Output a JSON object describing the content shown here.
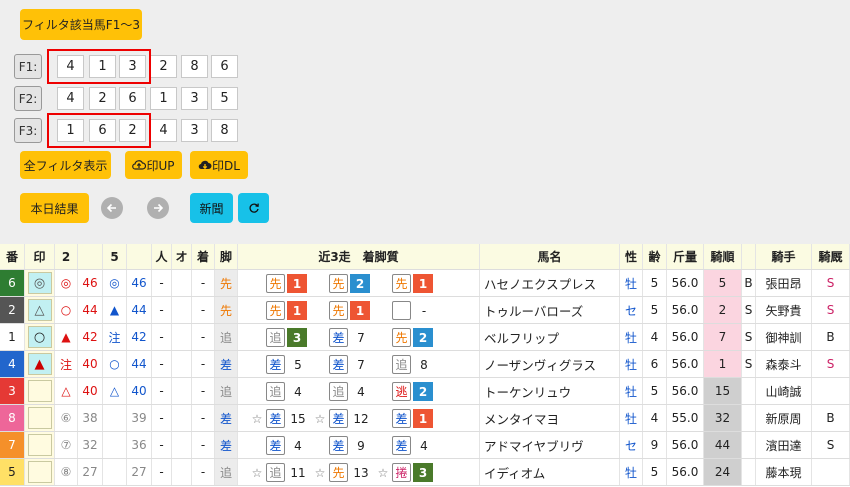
{
  "buttons": {
    "filter_hit": "フィルタ該当馬F1〜3",
    "all_filter": "全フィルタ表示",
    "upload": "印UP",
    "download": "印DL",
    "today_result": "本日結果",
    "new": "新聞"
  },
  "filters": [
    {
      "label": "F1:",
      "values": [
        "4",
        "1",
        "3",
        "2",
        "8",
        "6"
      ]
    },
    {
      "label": "F2:",
      "values": [
        "4",
        "2",
        "6",
        "1",
        "3",
        "5"
      ]
    },
    {
      "label": "F3:",
      "values": [
        "1",
        "6",
        "2",
        "4",
        "3",
        "8"
      ]
    }
  ],
  "colors": {
    "accent": "#ffc107",
    "cyan": "#17c1e8",
    "highlight": "#ee0000"
  },
  "table": {
    "headers": {
      "ban": "番",
      "mark": "印",
      "c2": "2",
      "c5": "5",
      "hito": "人",
      "o": "オ",
      "chaku": "着",
      "kyaku": "脚",
      "recent": "近3走　着脚質",
      "name": "馬名",
      "sex": "性",
      "age": "齢",
      "weight": "斤量",
      "rank": "騎順",
      "jockey": "騎手",
      "stable": "騎厩"
    },
    "rows": [
      {
        "ban": "6",
        "banBg": "#2e7d32",
        "banFg": "#fff",
        "mark": "◎",
        "markType": "dcircle",
        "m2": "◎",
        "m2c": "red",
        "n2": "46",
        "n2c": "red",
        "m5": "◎",
        "m5c": "blue",
        "n5": "46",
        "n5c": "blue",
        "hito": "-",
        "o": "",
        "chaku": "-",
        "kyaku": "先",
        "kyakuC": "orange",
        "pre": [
          "",
          "",
          ""
        ],
        "r": [
          {
            "s": "先",
            "sc": "orange",
            "n": "1",
            "nc": "#ee5533"
          },
          {
            "s": "先",
            "sc": "orange",
            "n": "2",
            "nc": "#2a8fcf"
          },
          {
            "s": "先",
            "sc": "orange",
            "n": "1",
            "nc": "#ee5533"
          }
        ],
        "name": "ハセノエクスプレス",
        "sex": "牡",
        "age": "5",
        "weight": "56.0",
        "rank": "5",
        "rankBg": "#fbd5e0",
        "b": "B",
        "jockey": "張田昂",
        "stable": "S",
        "stableC": "purple"
      },
      {
        "ban": "2",
        "banBg": "#555555",
        "banFg": "#fff",
        "mark": "△",
        "markType": "tri",
        "m2": "○",
        "m2c": "red",
        "n2": "44",
        "n2c": "red",
        "m5": "▲",
        "m5c": "blue",
        "n5": "44",
        "n5c": "blue",
        "hito": "-",
        "o": "",
        "chaku": "-",
        "kyaku": "先",
        "kyakuC": "orange",
        "pre": [
          "",
          "",
          ""
        ],
        "r": [
          {
            "s": "先",
            "sc": "orange",
            "n": "1",
            "nc": "#ee5533"
          },
          {
            "s": "先",
            "sc": "orange",
            "n": "1",
            "nc": "#ee5533"
          },
          {
            "s": "",
            "sc": "",
            "n": "-",
            "nc": ""
          }
        ],
        "name": "トゥルーバローズ",
        "sex": "セ",
        "age": "5",
        "weight": "56.0",
        "rank": "2",
        "rankBg": "#fbd5e0",
        "b": "S",
        "jockey": "矢野貴",
        "stable": "S",
        "stableC": "purple"
      },
      {
        "ban": "1",
        "banBg": "#ffffff",
        "banFg": "#222",
        "mark": "○",
        "markType": "circle",
        "m2": "▲",
        "m2c": "red",
        "n2": "42",
        "n2c": "red",
        "m5": "注",
        "m5c": "blue",
        "n5": "42",
        "n5c": "blue",
        "hito": "-",
        "o": "",
        "chaku": "-",
        "kyaku": "追",
        "kyakuC": "grey",
        "pre": [
          "",
          "",
          ""
        ],
        "r": [
          {
            "s": "追",
            "sc": "grey",
            "n": "3",
            "nc": "#4a7a2a"
          },
          {
            "s": "差",
            "sc": "blue",
            "n": "7",
            "nc": ""
          },
          {
            "s": "先",
            "sc": "orange",
            "n": "2",
            "nc": "#2a8fcf"
          }
        ],
        "name": "ベルフリップ",
        "sex": "牡",
        "age": "4",
        "weight": "56.0",
        "rank": "7",
        "rankBg": "#fbd5e0",
        "b": "S",
        "jockey": "御神訓",
        "stable": "B",
        "stableC": ""
      },
      {
        "ban": "4",
        "banBg": "#2266cc",
        "banFg": "#fff",
        "mark": "▲",
        "markType": "ftri",
        "m2": "注",
        "m2c": "red",
        "n2": "40",
        "n2c": "red",
        "m5": "○",
        "m5c": "blue",
        "n5": "44",
        "n5c": "blue",
        "hito": "-",
        "o": "",
        "chaku": "-",
        "kyaku": "差",
        "kyakuC": "blue",
        "pre": [
          "",
          "",
          ""
        ],
        "r": [
          {
            "s": "差",
            "sc": "blue",
            "n": "5",
            "nc": ""
          },
          {
            "s": "差",
            "sc": "blue",
            "n": "7",
            "nc": ""
          },
          {
            "s": "追",
            "sc": "grey",
            "n": "8",
            "nc": ""
          }
        ],
        "name": "ノーザンヴィグラス",
        "sex": "牡",
        "age": "6",
        "weight": "56.0",
        "rank": "1",
        "rankBg": "#fbd5e0",
        "b": "S",
        "jockey": "森泰斗",
        "stable": "S",
        "stableC": "purple"
      },
      {
        "ban": "3",
        "banBg": "#e53935",
        "banFg": "#fff",
        "mark": "",
        "markType": "",
        "m2": "△",
        "m2c": "red",
        "n2": "40",
        "n2c": "red",
        "m5": "△",
        "m5c": "blue",
        "n5": "40",
        "n5c": "blue",
        "hito": "-",
        "o": "",
        "chaku": "-",
        "kyaku": "追",
        "kyakuC": "grey",
        "pre": [
          "",
          "",
          ""
        ],
        "r": [
          {
            "s": "追",
            "sc": "grey",
            "n": "4",
            "nc": ""
          },
          {
            "s": "追",
            "sc": "grey",
            "n": "4",
            "nc": ""
          },
          {
            "s": "逃",
            "sc": "red",
            "n": "2",
            "nc": "#2a8fcf"
          }
        ],
        "name": "トーケンリュウ",
        "sex": "牡",
        "age": "5",
        "weight": "56.0",
        "rank": "15",
        "rankBg": "#cfcfcf",
        "b": "",
        "jockey": "山崎誠",
        "stable": "",
        "stableC": ""
      },
      {
        "ban": "8",
        "banBg": "#ee6699",
        "banFg": "#fff",
        "mark": "",
        "markType": "",
        "m2": "⑥",
        "m2c": "grey",
        "n2": "38",
        "n2c": "grey",
        "m5": "",
        "m5c": "",
        "n5": "39",
        "n5c": "grey",
        "hito": "-",
        "o": "",
        "chaku": "-",
        "kyaku": "差",
        "kyakuC": "blue",
        "pre": [
          "☆",
          "☆",
          ""
        ],
        "r": [
          {
            "s": "差",
            "sc": "blue",
            "n": "15",
            "nc": ""
          },
          {
            "s": "差",
            "sc": "blue",
            "n": "12",
            "nc": ""
          },
          {
            "s": "差",
            "sc": "blue",
            "n": "1",
            "nc": "#ee5533"
          }
        ],
        "name": "メンタイマヨ",
        "sex": "牡",
        "age": "4",
        "weight": "55.0",
        "rank": "32",
        "rankBg": "#cfcfcf",
        "b": "",
        "jockey": "新原周",
        "stable": "B",
        "stableC": ""
      },
      {
        "ban": "7",
        "banBg": "#f5902a",
        "banFg": "#fff",
        "mark": "",
        "markType": "",
        "m2": "⑦",
        "m2c": "grey",
        "n2": "32",
        "n2c": "grey",
        "m5": "",
        "m5c": "",
        "n5": "36",
        "n5c": "grey",
        "hito": "-",
        "o": "",
        "chaku": "-",
        "kyaku": "差",
        "kyakuC": "blue",
        "pre": [
          "",
          "",
          ""
        ],
        "r": [
          {
            "s": "差",
            "sc": "blue",
            "n": "4",
            "nc": ""
          },
          {
            "s": "差",
            "sc": "blue",
            "n": "9",
            "nc": ""
          },
          {
            "s": "差",
            "sc": "blue",
            "n": "4",
            "nc": ""
          }
        ],
        "name": "アドマイヤブリヴ",
        "sex": "セ",
        "age": "9",
        "weight": "56.0",
        "rank": "44",
        "rankBg": "#cfcfcf",
        "b": "",
        "jockey": "濱田達",
        "stable": "S",
        "stableC": ""
      },
      {
        "ban": "5",
        "banBg": "#ffe066",
        "banFg": "#222",
        "mark": "",
        "markType": "",
        "m2": "⑧",
        "m2c": "grey",
        "n2": "27",
        "n2c": "grey",
        "m5": "",
        "m5c": "",
        "n5": "27",
        "n5c": "grey",
        "hito": "-",
        "o": "",
        "chaku": "-",
        "kyaku": "追",
        "kyakuC": "grey",
        "pre": [
          "☆",
          "☆",
          "☆"
        ],
        "r": [
          {
            "s": "追",
            "sc": "grey",
            "n": "11",
            "nc": ""
          },
          {
            "s": "先",
            "sc": "orange",
            "n": "13",
            "nc": ""
          },
          {
            "s": "捲",
            "sc": "purple",
            "n": "3",
            "nc": "#4a7a2a"
          }
        ],
        "name": "イディオム",
        "sex": "牡",
        "age": "5",
        "weight": "56.0",
        "rank": "24",
        "rankBg": "#cfcfcf",
        "b": "",
        "jockey": "藤本現",
        "stable": "",
        "stableC": ""
      }
    ]
  }
}
